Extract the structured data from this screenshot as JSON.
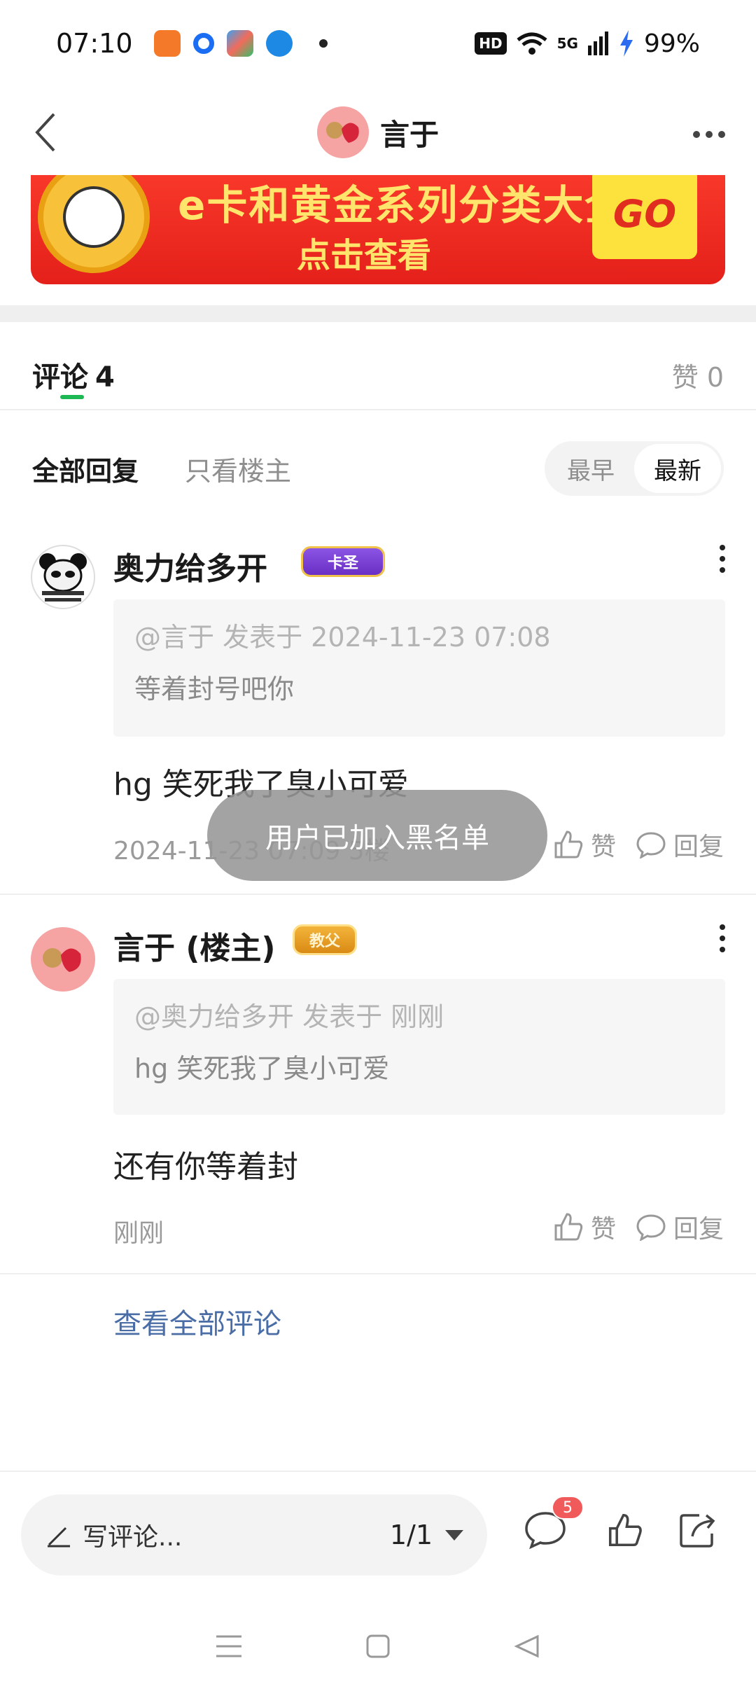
{
  "status_bar": {
    "time": "07:10",
    "hd": "HD",
    "network": "5G",
    "battery": "99%"
  },
  "header": {
    "title": "言于"
  },
  "banner": {
    "title": "e卡和黄金系列分类大全",
    "subtitle": "点击查看",
    "go_label": "GO"
  },
  "comments_header": {
    "tab_label": "评论",
    "count": "4",
    "likes_label": "赞 0"
  },
  "filter": {
    "all_label": "全部回复",
    "owner_only_label": "只看楼主",
    "sort_oldest": "最早",
    "sort_newest": "最新"
  },
  "comments": [
    {
      "name": "奥力给多开",
      "badge": "卡圣",
      "quote_meta": "@言于 发表于 2024-11-23 07:08",
      "quote_text": "等着封号吧你",
      "body": "hg 笑死我了臭小可爱",
      "meta": "2024-11-23 07:09 5楼",
      "like_label": "赞",
      "reply_label": "回复"
    },
    {
      "name": "言于 (楼主)",
      "badge": "教父",
      "quote_meta": "@奥力给多开 发表于 刚刚",
      "quote_text": "hg 笑死我了臭小可爱",
      "body": "还有你等着封",
      "meta": "刚刚",
      "like_label": "赞",
      "reply_label": "回复"
    }
  ],
  "view_all_label": "查看全部评论",
  "toast": "用户已加入黑名单",
  "bottom_bar": {
    "write_placeholder": "写评论...",
    "page_indicator": "1/1",
    "comment_badge": "5"
  },
  "colors": {
    "accent_green": "#1db854",
    "link_blue": "#4a6da6",
    "banner_red": "#e4201a",
    "badge_red": "#f15a5a"
  }
}
